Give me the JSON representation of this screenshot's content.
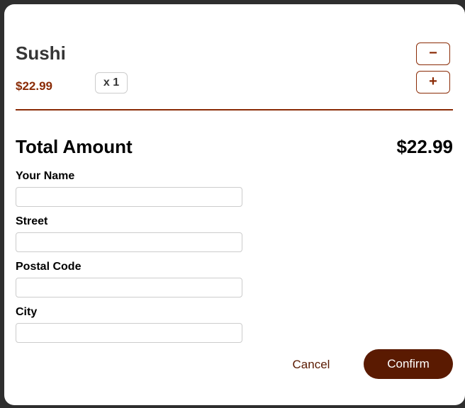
{
  "cart": {
    "item": {
      "name": "Sushi",
      "price": "$22.99",
      "quantity": "x 1"
    },
    "decrease_label": "−",
    "increase_label": "+"
  },
  "summary": {
    "total_label": "Total Amount",
    "total_value": "$22.99"
  },
  "checkout_form": {
    "fields": [
      {
        "label": "Your Name",
        "value": ""
      },
      {
        "label": "Street",
        "value": ""
      },
      {
        "label": "Postal Code",
        "value": ""
      },
      {
        "label": "City",
        "value": ""
      }
    ]
  },
  "actions": {
    "cancel_label": "Cancel",
    "confirm_label": "Confirm"
  },
  "colors": {
    "accent": "#8a2b06",
    "confirm_bg": "#5a1a01",
    "overlay": "#2e2e2e"
  }
}
